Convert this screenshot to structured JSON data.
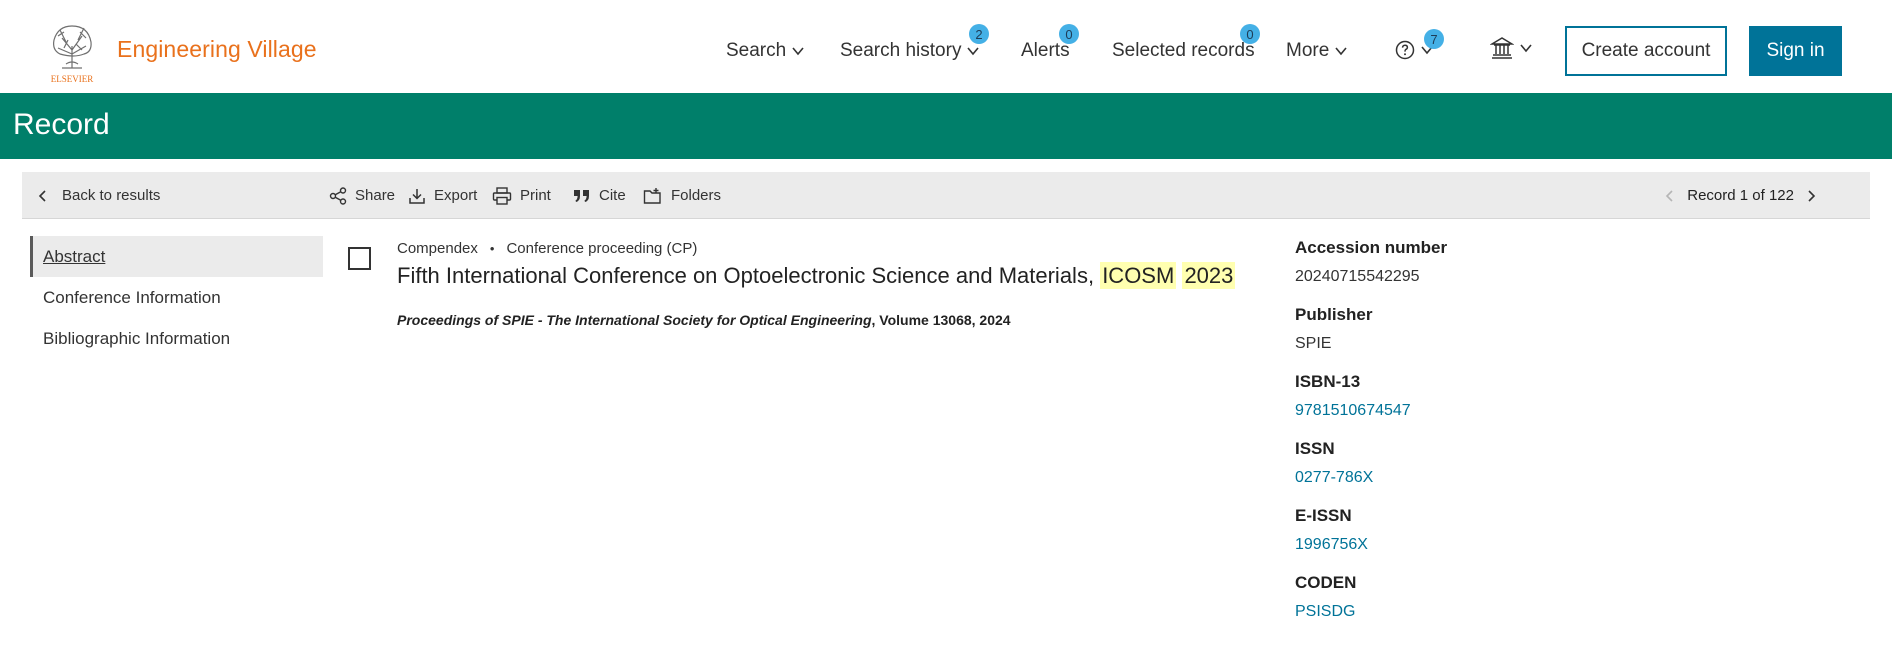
{
  "header": {
    "logo_text": "ELSEVIER",
    "brand": "Engineering Village",
    "nav": {
      "search": "Search",
      "search_history": "Search history",
      "search_history_count": "2",
      "alerts": "Alerts",
      "alerts_count": "0",
      "selected_records": "Selected records",
      "selected_records_count": "0",
      "more": "More",
      "help_count": "7"
    },
    "create_account": "Create account",
    "sign_in": "Sign in"
  },
  "banner": {
    "title": "Record"
  },
  "toolbar": {
    "back": "Back to results",
    "share": "Share",
    "export": "Export",
    "print": "Print",
    "cite": "Cite",
    "folders": "Folders",
    "record_position": "Record 1 of 122"
  },
  "leftnav": {
    "items": [
      "Abstract",
      "Conference Information",
      "Bibliographic Information"
    ]
  },
  "record": {
    "database": "Compendex",
    "doc_type": "Conference proceeding (CP)",
    "title_prefix": "Fifth International Conference on Optoelectronic Science and Materials,",
    "title_hl1": "ICOSM",
    "title_hl2": "2023",
    "source_title": "Proceedings of SPIE - The International Society for Optical Engineering",
    "source_rest": ", Volume 13068, 2024"
  },
  "details": [
    {
      "label": "Accession number",
      "value": "20240715542295",
      "link": false
    },
    {
      "label": "Publisher",
      "value": "SPIE",
      "link": false
    },
    {
      "label": "ISBN-13",
      "value": "9781510674547",
      "link": true
    },
    {
      "label": "ISSN",
      "value": "0277-786X",
      "link": true
    },
    {
      "label": "E-ISSN",
      "value": "1996756X",
      "link": true
    },
    {
      "label": "CODEN",
      "value": "PSISDG",
      "link": true
    }
  ],
  "colors": {
    "brand_orange": "#e9711c",
    "banner_green": "#007f6a",
    "primary_blue": "#007398",
    "badge_blue": "#44b0e6",
    "highlight": "#ffffb0"
  }
}
